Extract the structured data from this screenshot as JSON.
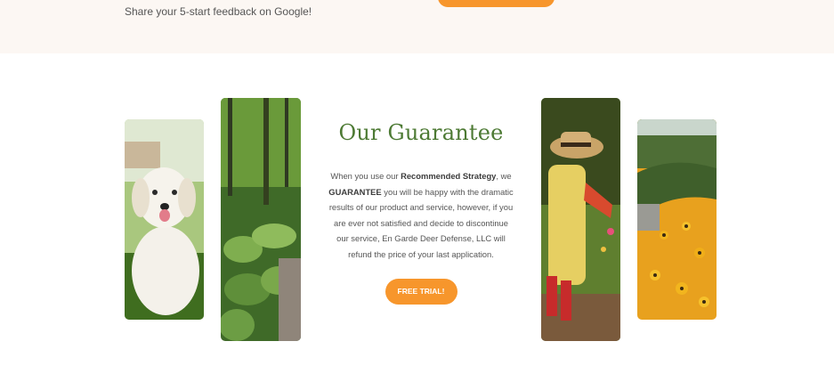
{
  "top": {
    "feedback_text": "Share your 5-start feedback on Google!"
  },
  "guarantee": {
    "title": "Our Guarantee",
    "body": {
      "t1": "When you use our ",
      "strong1": "Recommended Strategy",
      "t2": ", we ",
      "strong2": "GUARANTEE",
      "t3": " you will be happy with the dramatic results of our product and service, however, if you are ever not satisfied and decide to discontinue our service, En Garde Deer Defense, LLC will refund the price of your last application."
    },
    "cta_label": "FREE TRIAL!"
  },
  "colors": {
    "accent_orange": "#f7962c",
    "title_green": "#4d7a34",
    "top_band": "#fcf7f3"
  }
}
